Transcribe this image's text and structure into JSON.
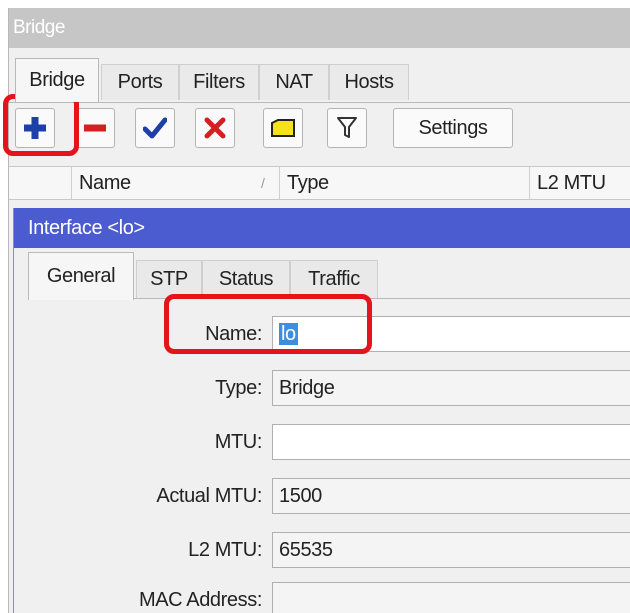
{
  "window": {
    "title": "Bridge"
  },
  "tabs": [
    "Bridge",
    "Ports",
    "Filters",
    "NAT",
    "Hosts"
  ],
  "toolbar": {
    "add_icon": "plus-icon",
    "remove_icon": "minus-icon",
    "enable_icon": "check-icon",
    "disable_icon": "x-icon",
    "comment_icon": "note-icon",
    "filter_icon": "filter-icon",
    "settings_label": "Settings"
  },
  "table": {
    "columns": [
      "Name",
      "Type",
      "L2 MTU"
    ],
    "sort_indicator": "/"
  },
  "dialog": {
    "title": "Interface <lo>",
    "tabs": [
      "General",
      "STP",
      "Status",
      "Traffic"
    ],
    "fields": {
      "name": {
        "label": "Name:",
        "value": "lo"
      },
      "type": {
        "label": "Type:",
        "value": "Bridge"
      },
      "mtu": {
        "label": "MTU:",
        "value": ""
      },
      "actual_mtu": {
        "label": "Actual MTU:",
        "value": "1500"
      },
      "l2_mtu": {
        "label": "L2 MTU:",
        "value": "65535"
      },
      "mac_address": {
        "label": "MAC Address:",
        "value": ""
      }
    }
  },
  "colors": {
    "highlight": "#e4141b",
    "dialog_title": "#4b5bd0",
    "add": "#1f3fa8",
    "remove": "#d42020",
    "enable": "#1f3fa8",
    "disable": "#d42020",
    "comment": "#e8d400"
  }
}
